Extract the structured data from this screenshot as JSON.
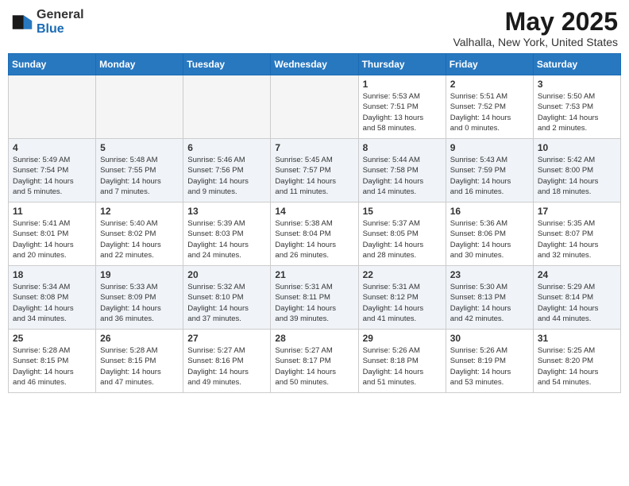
{
  "logo": {
    "general": "General",
    "blue": "Blue"
  },
  "title": "May 2025",
  "subtitle": "Valhalla, New York, United States",
  "days_of_week": [
    "Sunday",
    "Monday",
    "Tuesday",
    "Wednesday",
    "Thursday",
    "Friday",
    "Saturday"
  ],
  "weeks": [
    [
      {
        "day": "",
        "info": ""
      },
      {
        "day": "",
        "info": ""
      },
      {
        "day": "",
        "info": ""
      },
      {
        "day": "",
        "info": ""
      },
      {
        "day": "1",
        "info": "Sunrise: 5:53 AM\nSunset: 7:51 PM\nDaylight: 13 hours\nand 58 minutes."
      },
      {
        "day": "2",
        "info": "Sunrise: 5:51 AM\nSunset: 7:52 PM\nDaylight: 14 hours\nand 0 minutes."
      },
      {
        "day": "3",
        "info": "Sunrise: 5:50 AM\nSunset: 7:53 PM\nDaylight: 14 hours\nand 2 minutes."
      }
    ],
    [
      {
        "day": "4",
        "info": "Sunrise: 5:49 AM\nSunset: 7:54 PM\nDaylight: 14 hours\nand 5 minutes."
      },
      {
        "day": "5",
        "info": "Sunrise: 5:48 AM\nSunset: 7:55 PM\nDaylight: 14 hours\nand 7 minutes."
      },
      {
        "day": "6",
        "info": "Sunrise: 5:46 AM\nSunset: 7:56 PM\nDaylight: 14 hours\nand 9 minutes."
      },
      {
        "day": "7",
        "info": "Sunrise: 5:45 AM\nSunset: 7:57 PM\nDaylight: 14 hours\nand 11 minutes."
      },
      {
        "day": "8",
        "info": "Sunrise: 5:44 AM\nSunset: 7:58 PM\nDaylight: 14 hours\nand 14 minutes."
      },
      {
        "day": "9",
        "info": "Sunrise: 5:43 AM\nSunset: 7:59 PM\nDaylight: 14 hours\nand 16 minutes."
      },
      {
        "day": "10",
        "info": "Sunrise: 5:42 AM\nSunset: 8:00 PM\nDaylight: 14 hours\nand 18 minutes."
      }
    ],
    [
      {
        "day": "11",
        "info": "Sunrise: 5:41 AM\nSunset: 8:01 PM\nDaylight: 14 hours\nand 20 minutes."
      },
      {
        "day": "12",
        "info": "Sunrise: 5:40 AM\nSunset: 8:02 PM\nDaylight: 14 hours\nand 22 minutes."
      },
      {
        "day": "13",
        "info": "Sunrise: 5:39 AM\nSunset: 8:03 PM\nDaylight: 14 hours\nand 24 minutes."
      },
      {
        "day": "14",
        "info": "Sunrise: 5:38 AM\nSunset: 8:04 PM\nDaylight: 14 hours\nand 26 minutes."
      },
      {
        "day": "15",
        "info": "Sunrise: 5:37 AM\nSunset: 8:05 PM\nDaylight: 14 hours\nand 28 minutes."
      },
      {
        "day": "16",
        "info": "Sunrise: 5:36 AM\nSunset: 8:06 PM\nDaylight: 14 hours\nand 30 minutes."
      },
      {
        "day": "17",
        "info": "Sunrise: 5:35 AM\nSunset: 8:07 PM\nDaylight: 14 hours\nand 32 minutes."
      }
    ],
    [
      {
        "day": "18",
        "info": "Sunrise: 5:34 AM\nSunset: 8:08 PM\nDaylight: 14 hours\nand 34 minutes."
      },
      {
        "day": "19",
        "info": "Sunrise: 5:33 AM\nSunset: 8:09 PM\nDaylight: 14 hours\nand 36 minutes."
      },
      {
        "day": "20",
        "info": "Sunrise: 5:32 AM\nSunset: 8:10 PM\nDaylight: 14 hours\nand 37 minutes."
      },
      {
        "day": "21",
        "info": "Sunrise: 5:31 AM\nSunset: 8:11 PM\nDaylight: 14 hours\nand 39 minutes."
      },
      {
        "day": "22",
        "info": "Sunrise: 5:31 AM\nSunset: 8:12 PM\nDaylight: 14 hours\nand 41 minutes."
      },
      {
        "day": "23",
        "info": "Sunrise: 5:30 AM\nSunset: 8:13 PM\nDaylight: 14 hours\nand 42 minutes."
      },
      {
        "day": "24",
        "info": "Sunrise: 5:29 AM\nSunset: 8:14 PM\nDaylight: 14 hours\nand 44 minutes."
      }
    ],
    [
      {
        "day": "25",
        "info": "Sunrise: 5:28 AM\nSunset: 8:15 PM\nDaylight: 14 hours\nand 46 minutes."
      },
      {
        "day": "26",
        "info": "Sunrise: 5:28 AM\nSunset: 8:15 PM\nDaylight: 14 hours\nand 47 minutes."
      },
      {
        "day": "27",
        "info": "Sunrise: 5:27 AM\nSunset: 8:16 PM\nDaylight: 14 hours\nand 49 minutes."
      },
      {
        "day": "28",
        "info": "Sunrise: 5:27 AM\nSunset: 8:17 PM\nDaylight: 14 hours\nand 50 minutes."
      },
      {
        "day": "29",
        "info": "Sunrise: 5:26 AM\nSunset: 8:18 PM\nDaylight: 14 hours\nand 51 minutes."
      },
      {
        "day": "30",
        "info": "Sunrise: 5:26 AM\nSunset: 8:19 PM\nDaylight: 14 hours\nand 53 minutes."
      },
      {
        "day": "31",
        "info": "Sunrise: 5:25 AM\nSunset: 8:20 PM\nDaylight: 14 hours\nand 54 minutes."
      }
    ]
  ]
}
